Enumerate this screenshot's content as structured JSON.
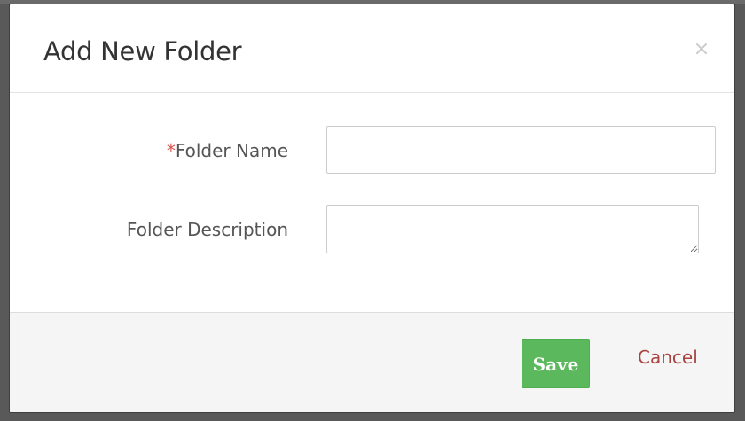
{
  "modal": {
    "title": "Add New Folder",
    "close_label": "×"
  },
  "form": {
    "folder_name": {
      "required_marker": "*",
      "label": "Folder Name",
      "value": "",
      "placeholder": ""
    },
    "folder_description": {
      "label": "Folder Description",
      "value": "",
      "placeholder": ""
    }
  },
  "footer": {
    "save_label": "Save",
    "cancel_label": "Cancel"
  },
  "colors": {
    "save_button": "#5cb85c",
    "cancel_link": "#a94442",
    "required_marker": "#d9534f",
    "overlay": "#595959"
  }
}
